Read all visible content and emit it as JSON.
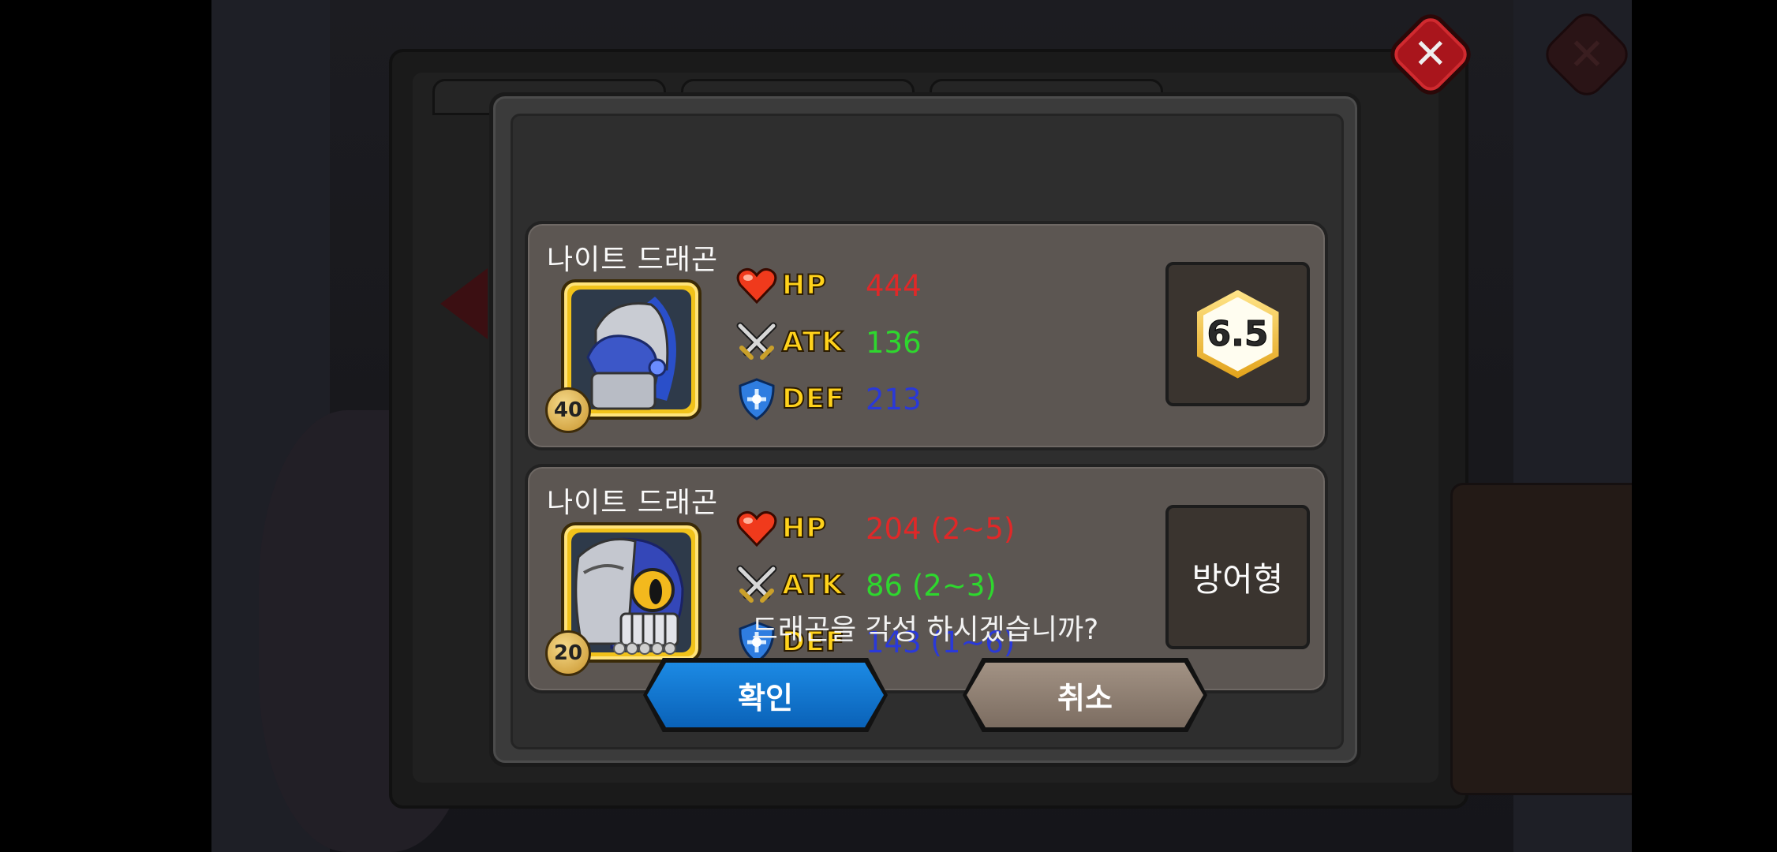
{
  "dialog": {
    "cards": [
      {
        "name": "나이트 드래곤",
        "level": "40",
        "stats": {
          "hp_label": "HP",
          "hp_value": "444",
          "atk_label": "ATK",
          "atk_value": "136",
          "def_label": "DEF",
          "def_value": "213"
        },
        "grade": "6.5"
      },
      {
        "name": "나이트 드래곤",
        "level": "20",
        "stats": {
          "hp_label": "HP",
          "hp_value": "204 (2~5)",
          "atk_label": "ATK",
          "atk_value": "86 (2~3)",
          "def_label": "DEF",
          "def_value": "143 (1~6)"
        },
        "type": "방어형"
      }
    ],
    "question": "드래곤을 각성 하시겠습니까?",
    "confirm_label": "확인",
    "cancel_label": "취소"
  },
  "icons": {
    "close": "close-icon",
    "hp": "heart-icon",
    "atk": "crossed-swords-icon",
    "def": "shield-icon"
  },
  "colors": {
    "hp": "#e02828",
    "atk": "#2ed72e",
    "def": "#2a39d8",
    "stat_label": "#ffd21b",
    "confirm": "#1479d2",
    "cancel": "#8f8073"
  }
}
